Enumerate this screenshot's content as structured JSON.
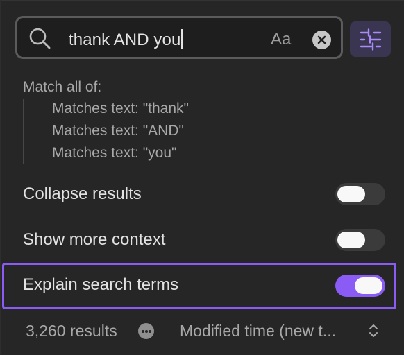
{
  "search": {
    "query": "thank AND you",
    "case_toggle_label": "Aa"
  },
  "explain": {
    "title": "Match all of:",
    "items": [
      "Matches text: \"thank\"",
      "Matches text: \"AND\"",
      "Matches text: \"you\""
    ]
  },
  "options": [
    {
      "label": "Collapse results",
      "enabled": false
    },
    {
      "label": "Show more context",
      "enabled": false
    },
    {
      "label": "Explain search terms",
      "enabled": true
    }
  ],
  "footer": {
    "results_count": "3,260 results",
    "sort_label": "Modified time (new t..."
  },
  "colors": {
    "accent": "#8a5cf5",
    "background": "#262626"
  },
  "icons": [
    "search-icon",
    "clear-icon",
    "sliders-icon",
    "more-icon",
    "chevron-up-down-icon"
  ]
}
